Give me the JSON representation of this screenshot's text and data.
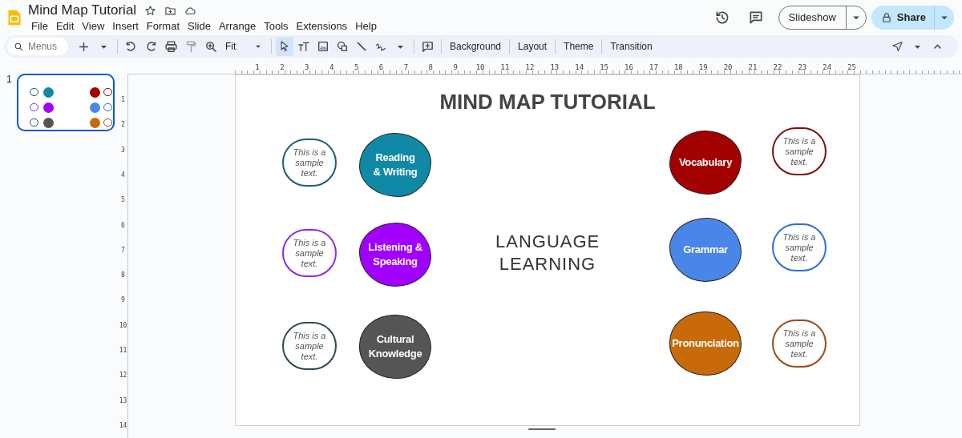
{
  "app": {
    "title": "Mind Map Tutorial",
    "menu": [
      "File",
      "Edit",
      "View",
      "Insert",
      "Format",
      "Slide",
      "Arrange",
      "Tools",
      "Extensions",
      "Help"
    ]
  },
  "header": {
    "slideshow": "Slideshow",
    "share": "Share"
  },
  "toolbar": {
    "search": {
      "placeholder": "Menus"
    },
    "zoom": "Fit",
    "tools": [
      {
        "kind": "select",
        "selected": true
      },
      {
        "kind": "textbox",
        "selected": false
      },
      {
        "kind": "image",
        "selected": false
      },
      {
        "kind": "shape",
        "selected": false
      },
      {
        "kind": "line",
        "selected": false
      },
      {
        "kind": "scribble",
        "selected": false
      }
    ],
    "buttons": [
      "Background",
      "Layout",
      "Theme",
      "Transition"
    ]
  },
  "filmstrip": [
    {
      "number": "1",
      "selected": true
    }
  ],
  "rulers": {
    "horizontal": [
      "1",
      "2",
      "3",
      "4",
      "5",
      "6",
      "7",
      "8",
      "9",
      "10",
      "11",
      "12",
      "13",
      "14",
      "15",
      "16",
      "17",
      "18",
      "19",
      "20",
      "21",
      "22",
      "23",
      "24",
      "25"
    ],
    "vertical": [
      "1",
      "2",
      "3",
      "4",
      "5",
      "6",
      "7",
      "8",
      "9",
      "10",
      "11",
      "12",
      "13",
      "14"
    ]
  },
  "slide": {
    "title": "MIND MAP TUTORIAL",
    "center": "LANGUAGE LEARNING",
    "topics": [
      {
        "label": "Reading\n& Writing",
        "color": "#1089a6",
        "note": {
          "text": "This is a sample text.",
          "color": "#1c5f73"
        }
      },
      {
        "label": "Listening &\nSpeaking",
        "color": "#a100ff",
        "note": {
          "text": "This is a sample text.",
          "color": "#8a2be2"
        }
      },
      {
        "label": "Cultural\nKnowledge",
        "color": "#555555",
        "note": {
          "text": "This is a sample text.",
          "color": "#2d4a4f"
        }
      },
      {
        "label": "Vocabulary",
        "color": "#a30000",
        "note": {
          "text": "This is a sample text.",
          "color": "#7a1010"
        }
      },
      {
        "label": "Grammar",
        "color": "#4a86e8",
        "note": {
          "text": "This is a sample text.",
          "color": "#2a6fd6"
        }
      },
      {
        "label": "Pronunciation",
        "color": "#c96a0a",
        "note": {
          "text": "This is a sample text.",
          "color": "#9a4b12"
        }
      }
    ]
  }
}
